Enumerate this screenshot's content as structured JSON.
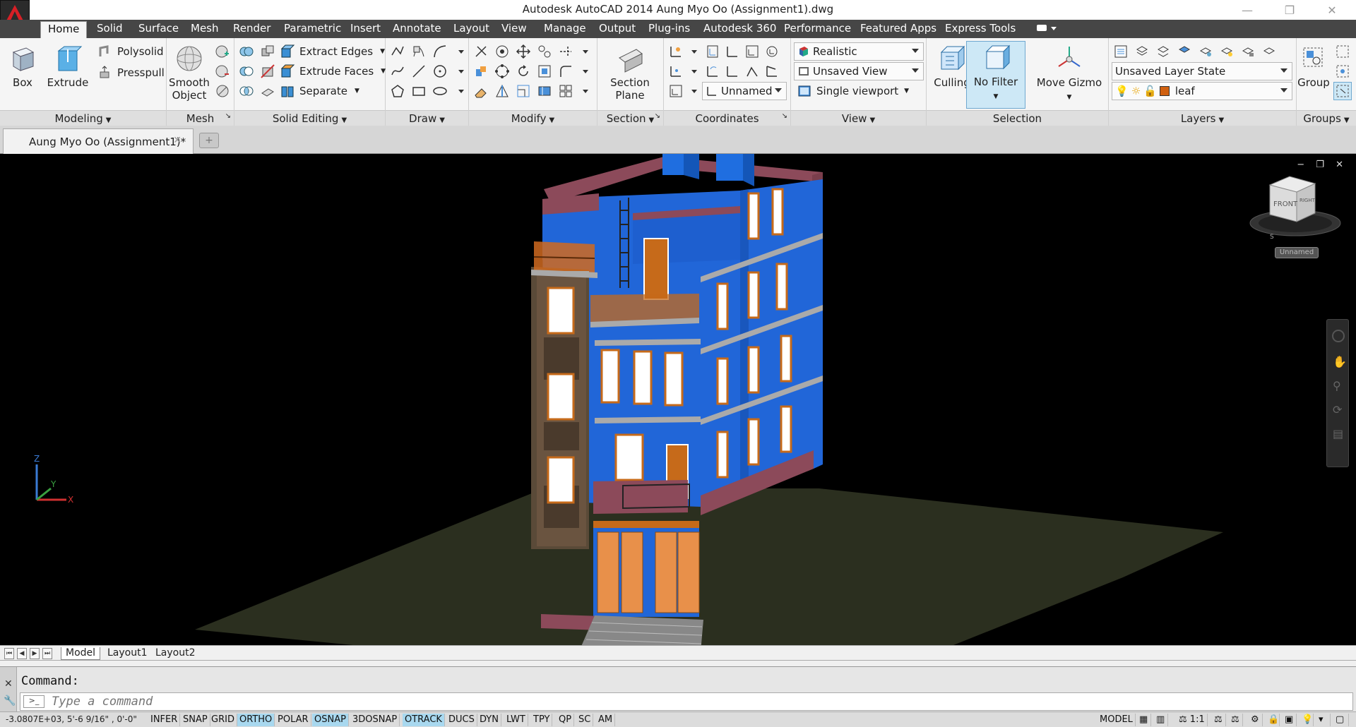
{
  "app": {
    "title": "Autodesk AutoCAD 2014    Aung Myo Oo (Assignment1).dwg",
    "accent": "#d71f26"
  },
  "window_controls": {
    "minimize": "—",
    "restore": "❐",
    "close": "✕"
  },
  "ribbon_tabs": [
    "Home",
    "Solid",
    "Surface",
    "Mesh",
    "Render",
    "Parametric",
    "Insert",
    "Annotate",
    "Layout",
    "View",
    "Manage",
    "Output",
    "Plug-ins",
    "Autodesk 360",
    "Performance",
    "Featured Apps",
    "Express Tools"
  ],
  "ribbon": {
    "modeling": {
      "label": "Modeling",
      "box": "Box",
      "extrude": "Extrude",
      "polysolid": "Polysolid",
      "presspull": "Presspull"
    },
    "mesh": {
      "label": "Mesh",
      "smooth_object_1": "Smooth",
      "smooth_object_2": "Object"
    },
    "solid_editing": {
      "label": "Solid Editing",
      "extract_edges": "Extract Edges",
      "extrude_faces": "Extrude Faces",
      "separate": "Separate"
    },
    "draw": {
      "label": "Draw"
    },
    "modify": {
      "label": "Modify"
    },
    "section": {
      "label": "Section",
      "section_plane_1": "Section",
      "section_plane_2": "Plane"
    },
    "coordinates": {
      "label": "Coordinates",
      "ucs_name": "Unnamed"
    },
    "view": {
      "label": "View",
      "visual_style": "Realistic",
      "named_view": "Unsaved View",
      "viewport": "Single viewport"
    },
    "selection": {
      "label": "Selection",
      "culling": "Culling",
      "no_filter": "No Filter",
      "move_gizmo": "Move Gizmo"
    },
    "layers": {
      "label": "Layers",
      "layer_state": "Unsaved Layer State",
      "current_layer": "leaf"
    },
    "groups": {
      "label": "Groups",
      "group": "Group"
    }
  },
  "document_tab": {
    "label": "Aung Myo Oo (Assignment1)*",
    "close": "✕",
    "new_tab": "+"
  },
  "viewport": {
    "controls": "− ❐ ✕",
    "viewcube_front": "FRONT",
    "viewcube_right": "RIGHT",
    "viewcube_compass_s": "S",
    "ucs_label": "Unnamed",
    "axis_x": "X",
    "axis_y": "Y",
    "axis_z": "Z"
  },
  "layout_tabs": [
    "Model",
    "Layout1",
    "Layout2"
  ],
  "command": {
    "history": "Command:",
    "placeholder": "Type a command"
  },
  "statusbar": {
    "coords": "-3.0807E+03, 5'-6 9/16\" , 0'-0\"",
    "toggles": [
      {
        "label": "INFER",
        "on": false
      },
      {
        "label": "SNAP",
        "on": false
      },
      {
        "label": "GRID",
        "on": false
      },
      {
        "label": "ORTHO",
        "on": true
      },
      {
        "label": "POLAR",
        "on": false
      },
      {
        "label": "OSNAP",
        "on": true
      },
      {
        "label": "3DOSNAP",
        "on": false
      },
      {
        "label": "OTRACK",
        "on": true
      },
      {
        "label": "DUCS",
        "on": false
      },
      {
        "label": "DYN",
        "on": false
      },
      {
        "label": "LWT",
        "on": false
      },
      {
        "label": "TPY",
        "on": false
      },
      {
        "label": "QP",
        "on": false
      },
      {
        "label": "SC",
        "on": false
      },
      {
        "label": "AM",
        "on": false
      }
    ],
    "model": "MODEL",
    "scale": "1:1"
  }
}
